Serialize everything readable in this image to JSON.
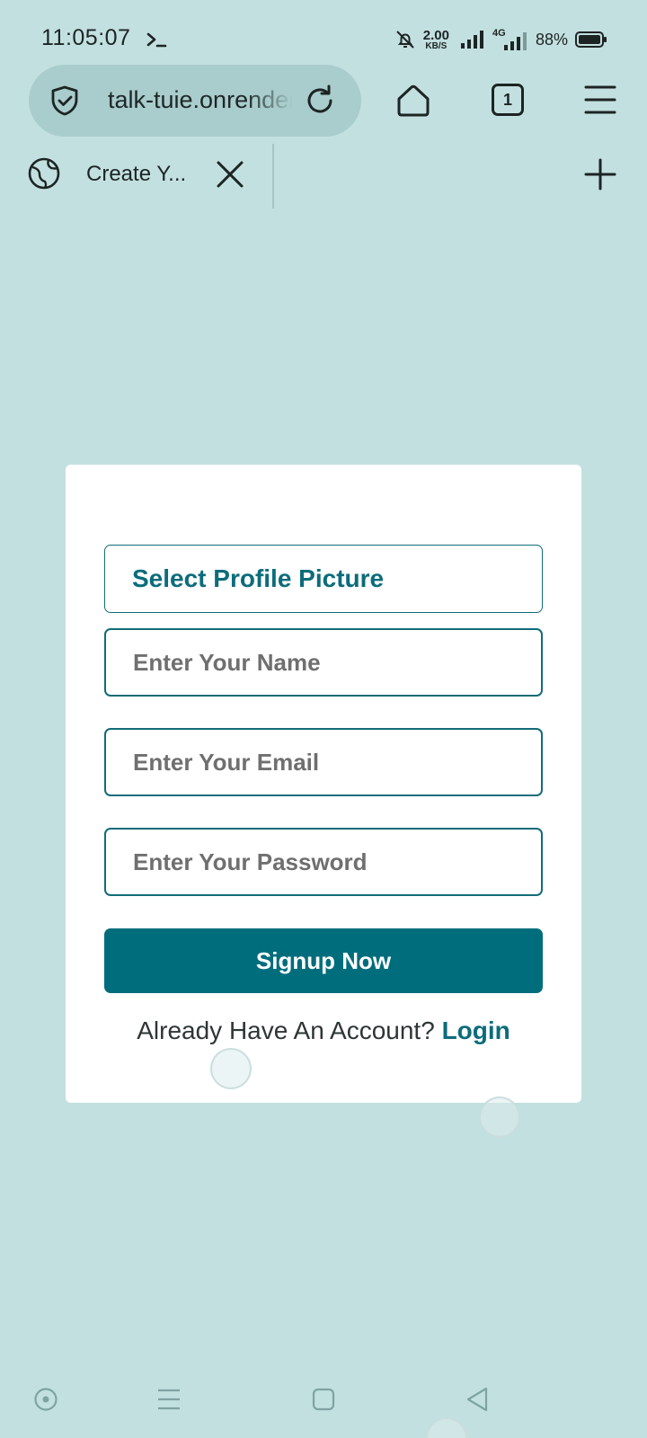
{
  "status_bar": {
    "time": "11:05:07",
    "speed_value": "2.00",
    "speed_unit": "KB/S",
    "network": "4G",
    "battery": "88%"
  },
  "browser": {
    "url": "talk-tuie.onrender",
    "tab_count": "1",
    "tab_title": "Create Y..."
  },
  "form": {
    "profile_picture_label": "Select Profile Picture",
    "name_placeholder": "Enter Your Name",
    "email_placeholder": "Enter Your Email",
    "password_placeholder": "Enter Your Password",
    "signup_label": "Signup Now",
    "account_prompt": "Already Have An Account?",
    "login_label": "Login"
  },
  "colors": {
    "background": "#c3e0e0",
    "accent": "#006d7c",
    "card": "#ffffff"
  },
  "icons": [
    "terminal-icon",
    "bell-off-icon",
    "signal-icon",
    "battery-icon",
    "shield-check-icon",
    "reload-icon",
    "home-icon",
    "menu-icon",
    "globe-icon",
    "close-icon",
    "plus-icon",
    "circle-dot-icon",
    "hamburger-icon",
    "square-icon",
    "back-triangle-icon"
  ]
}
